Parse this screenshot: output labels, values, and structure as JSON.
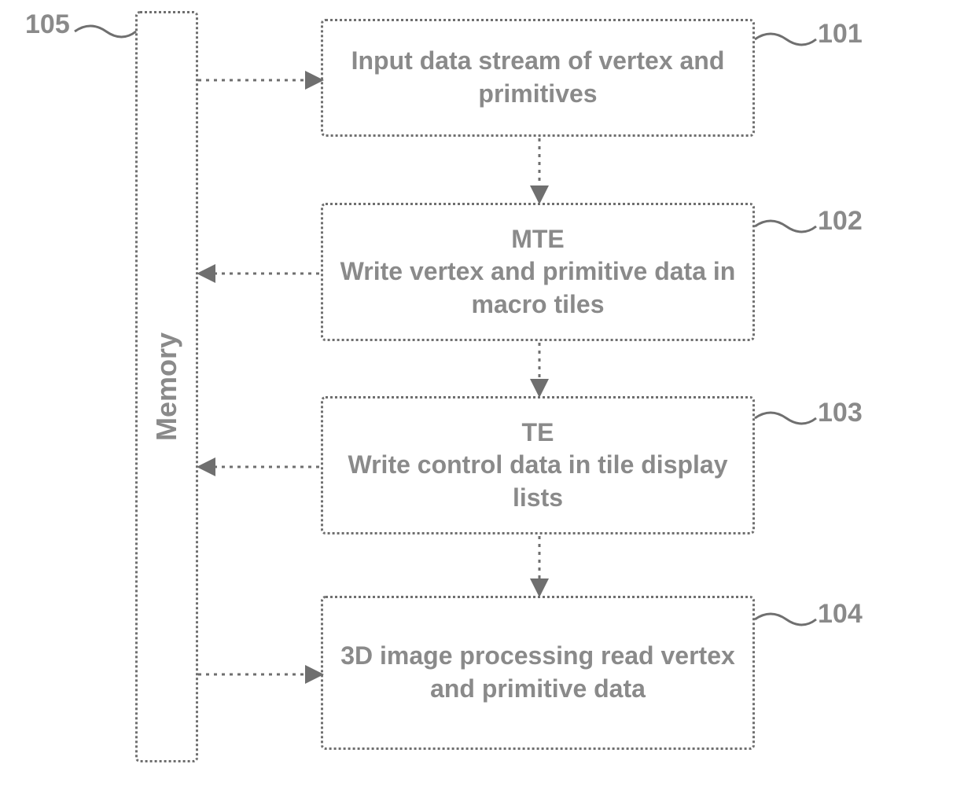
{
  "memory": {
    "label": "Memory",
    "ref": "105"
  },
  "blocks": {
    "b101": {
      "text": "Input data stream of vertex and primitives",
      "ref": "101"
    },
    "b102": {
      "text": "MTE\nWrite vertex and primitive data in macro tiles",
      "ref": "102"
    },
    "b103": {
      "text": "TE\nWrite control data in tile display lists",
      "ref": "103"
    },
    "b104": {
      "text": "3D image processing read vertex and primitive data",
      "ref": "104"
    }
  }
}
